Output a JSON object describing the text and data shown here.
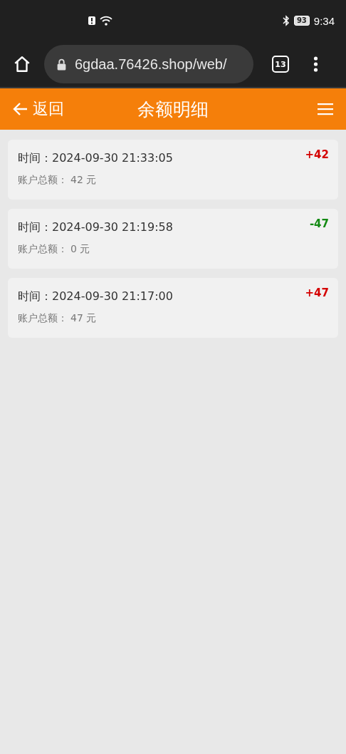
{
  "status_bar": {
    "battery": "93",
    "time": "9:34"
  },
  "browser": {
    "url": "6gdaa.76426.shop/web/",
    "tab_count": "13"
  },
  "header": {
    "back_label": "返回",
    "title": "余额明细"
  },
  "records": [
    {
      "time_label": "时间：",
      "time": "2024-09-30 21:33:05",
      "balance_label": "账户总额：",
      "balance": "42 元",
      "amount": "+42",
      "color": "#d40000"
    },
    {
      "time_label": "时间：",
      "time": "2024-09-30 21:19:58",
      "balance_label": "账户总额：",
      "balance": "0 元",
      "amount": "-47",
      "color": "#138a13"
    },
    {
      "time_label": "时间：",
      "time": "2024-09-30 21:17:00",
      "balance_label": "账户总额：",
      "balance": "47 元",
      "amount": "+47",
      "color": "#d40000"
    }
  ]
}
